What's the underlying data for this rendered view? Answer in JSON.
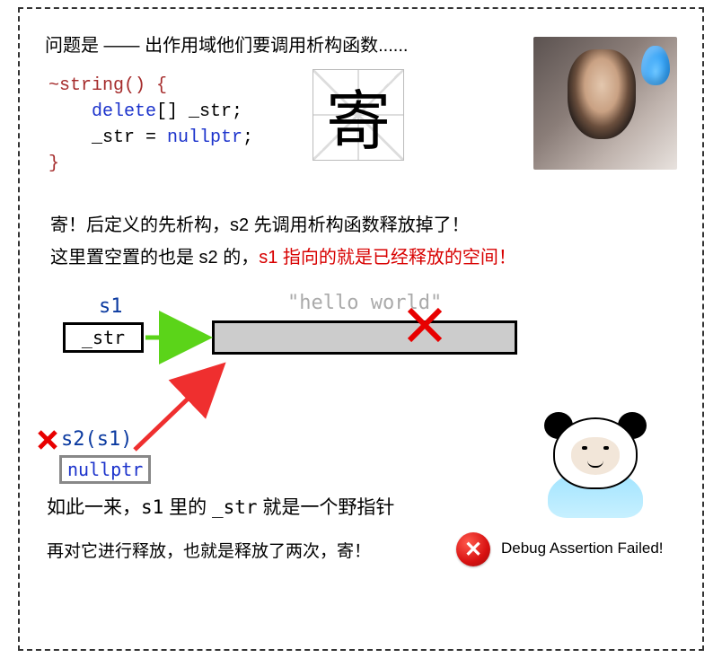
{
  "heading": "问题是 —— 出作用域他们要调用析构函数......",
  "code": {
    "sig": "~string() {",
    "delete_kw": "delete",
    "delete_rest": "[] _str;",
    "assign_left": "_str = ",
    "nullptr_kw": "nullptr",
    "assign_end": ";",
    "close": "}"
  },
  "char_ji": "寄",
  "para2_line1": "寄！后定义的先析构，s2 先调用析构函数释放掉了！",
  "para2_line2a": "这里置空置的也是 s2 的，",
  "para2_line2b": "s1 指向的就是已经释放的空间！",
  "diagram": {
    "s1_label": "s1",
    "s1_box": "_str",
    "hello": "\"hello world\"",
    "s2_label": "s2(s1)",
    "s2_box": "nullptr"
  },
  "para3_prefix": "如此一来，",
  "para3_code1": "s1",
  "para3_mid": " 里的 ",
  "para3_code2": "_str",
  "para3_suffix": " 就是一个野指针",
  "bottom_text": "再对它进行释放，也就是释放了两次，寄！",
  "error_text": "Debug Assertion Failed!",
  "error_x": "✕"
}
